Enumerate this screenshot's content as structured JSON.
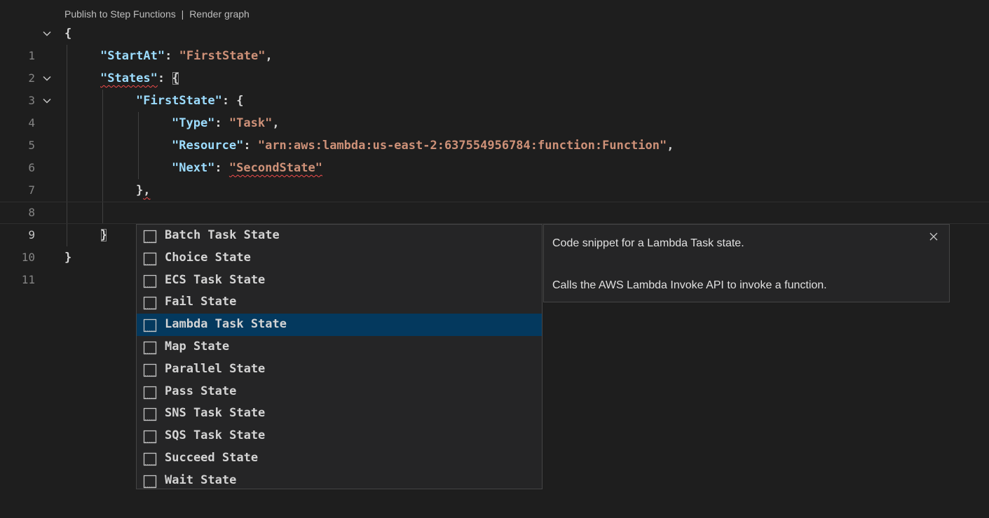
{
  "codelens": {
    "publish": "Publish to Step Functions",
    "separator": "|",
    "render": "Render graph"
  },
  "gutter": [
    "1",
    "2",
    "3",
    "4",
    "5",
    "6",
    "7",
    "8",
    "9",
    "10",
    "11"
  ],
  "code": {
    "l1_open": "{",
    "l2_key": "\"StartAt\"",
    "l2_colon": ": ",
    "l2_val": "\"FirstState\"",
    "l2_comma": ",",
    "l3_key": "\"States\"",
    "l3_colon": ": ",
    "l3_open": "{",
    "l4_key": "\"FirstState\"",
    "l4_rest": ": {",
    "l5_key": "\"Type\"",
    "l5_colon": ": ",
    "l5_val": "\"Task\"",
    "l5_comma": ",",
    "l6_key": "\"Resource\"",
    "l6_colon": ": ",
    "l6_val": "\"arn:aws:lambda:us-east-2:637554956784:function:Function\"",
    "l6_comma": ",",
    "l7_key": "\"Next\"",
    "l7_colon": ": ",
    "l7_val": "\"SecondState\"",
    "l8_close": "}",
    "l8_comma": ",",
    "l10_close": "}",
    "l11_close": "}"
  },
  "suggestions": [
    {
      "label": "Batch Task State"
    },
    {
      "label": "Choice State"
    },
    {
      "label": "ECS Task State"
    },
    {
      "label": "Fail State"
    },
    {
      "label": "Lambda Task State",
      "selected": true
    },
    {
      "label": "Map State"
    },
    {
      "label": "Parallel State"
    },
    {
      "label": "Pass State"
    },
    {
      "label": "SNS Task State"
    },
    {
      "label": "SQS Task State"
    },
    {
      "label": "Succeed State"
    },
    {
      "label": "Wait State"
    }
  ],
  "details": {
    "title": "Code snippet for a Lambda Task state.",
    "description": "Calls the AWS Lambda Invoke API to invoke a function."
  },
  "colors": {
    "background": "#1e1e1e",
    "key": "#9cdcfe",
    "string": "#ce9178",
    "selection": "#04395e",
    "error_squiggle": "#f14c4c"
  }
}
